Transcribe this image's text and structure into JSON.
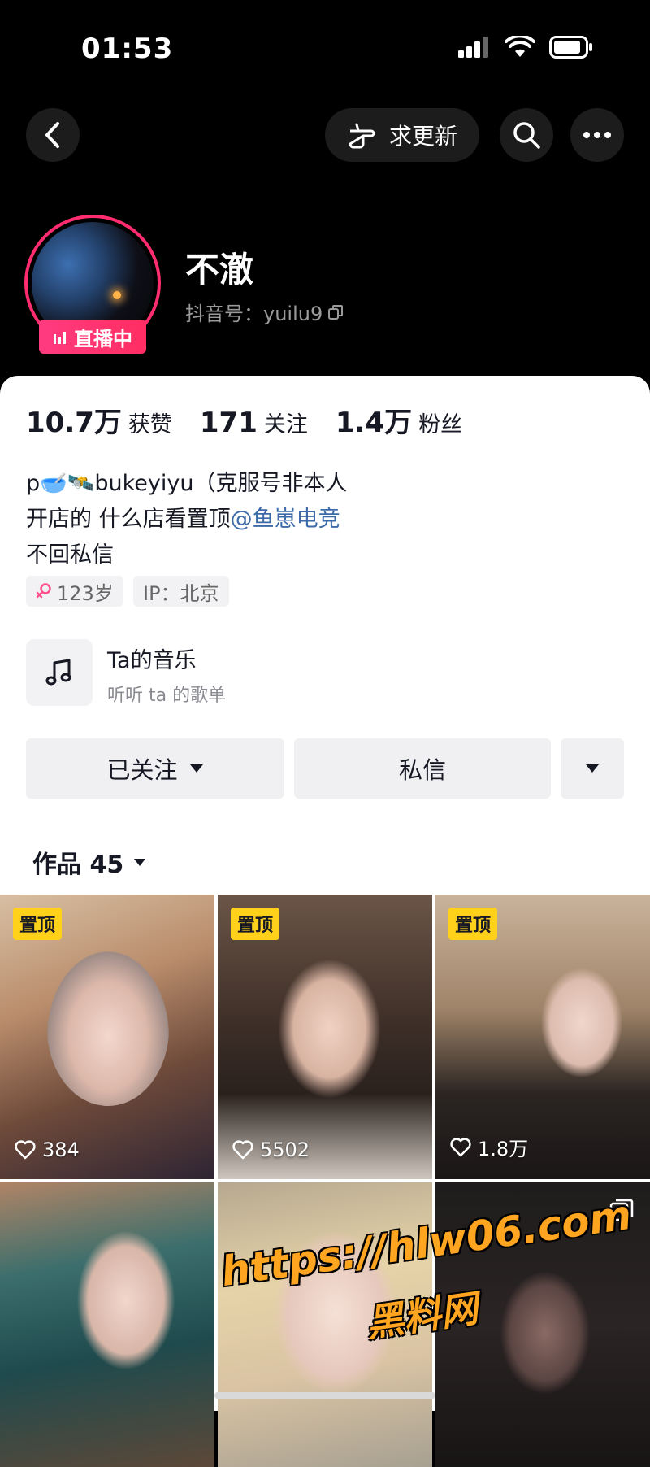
{
  "status_bar": {
    "time": "01:53"
  },
  "nav": {
    "update_request_label": "求更新"
  },
  "profile": {
    "live_badge": "直播中",
    "nickname": "不澈",
    "douyin_id": "抖音号：yuilu9"
  },
  "stats": [
    {
      "num": "10.7万",
      "label": "获赞"
    },
    {
      "num": "171",
      "label": "关注"
    },
    {
      "num": "1.4万",
      "label": "粉丝"
    }
  ],
  "bio": {
    "line1": "p🥣🛰️bukeyiyu（克服号非本人",
    "line2_prefix": "开店的 什么店看置顶",
    "line2_mention": "@鱼崽电竞",
    "line3": "不回私信"
  },
  "tags": {
    "age": "123岁",
    "ip": "IP：北京"
  },
  "music": {
    "title": "Ta的音乐",
    "subtitle": "听听 ta 的歌单"
  },
  "actions": {
    "follow_label": "已关注",
    "message_label": "私信"
  },
  "works": {
    "tab_label": "作品 45"
  },
  "grid": [
    {
      "pinned": "置顶",
      "likes": "384"
    },
    {
      "pinned": "置顶",
      "likes": "5502"
    },
    {
      "pinned": "置顶",
      "likes": "1.8万"
    },
    {
      "pinned": "",
      "likes": ""
    },
    {
      "pinned": "",
      "likes": ""
    },
    {
      "pinned": "",
      "likes": ""
    }
  ],
  "watermark": {
    "url": "https://hlw06.com",
    "name": "黑料网"
  },
  "colors": {
    "live": "#ff2d6f",
    "pin": "#ffd11a",
    "mention": "#3c6aa8"
  }
}
